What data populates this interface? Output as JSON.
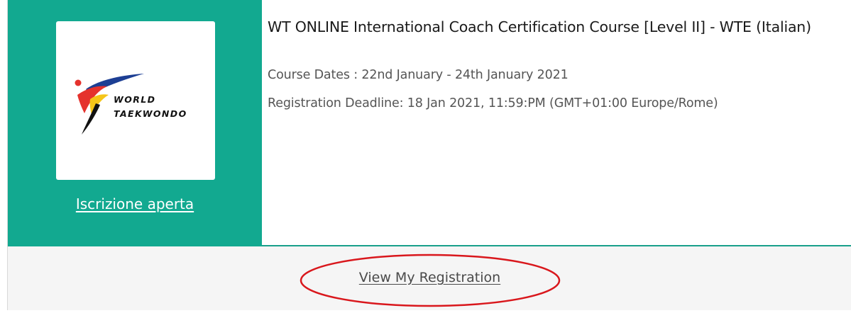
{
  "course": {
    "title": "WT ONLINE International Coach Certification Course [Level II] - WTE (Italian)",
    "dates": "Course Dates : 22nd January - 24th January 2021",
    "deadline": "Registration Deadline: 18 Jan 2021, 11:59:PM (GMT+01:00 Europe/Rome)"
  },
  "logo": {
    "line1": "WORLD",
    "line2": "TAEKWONDO",
    "colors": {
      "blue": "#1d3f94",
      "red": "#e5322d",
      "yellow": "#f5c518",
      "black": "#111111"
    }
  },
  "status_link": "Iscrizione aperta",
  "view_registration_link": "View My Registration",
  "colors": {
    "accent_green": "#12a990",
    "annotation_red": "#d9171c"
  }
}
